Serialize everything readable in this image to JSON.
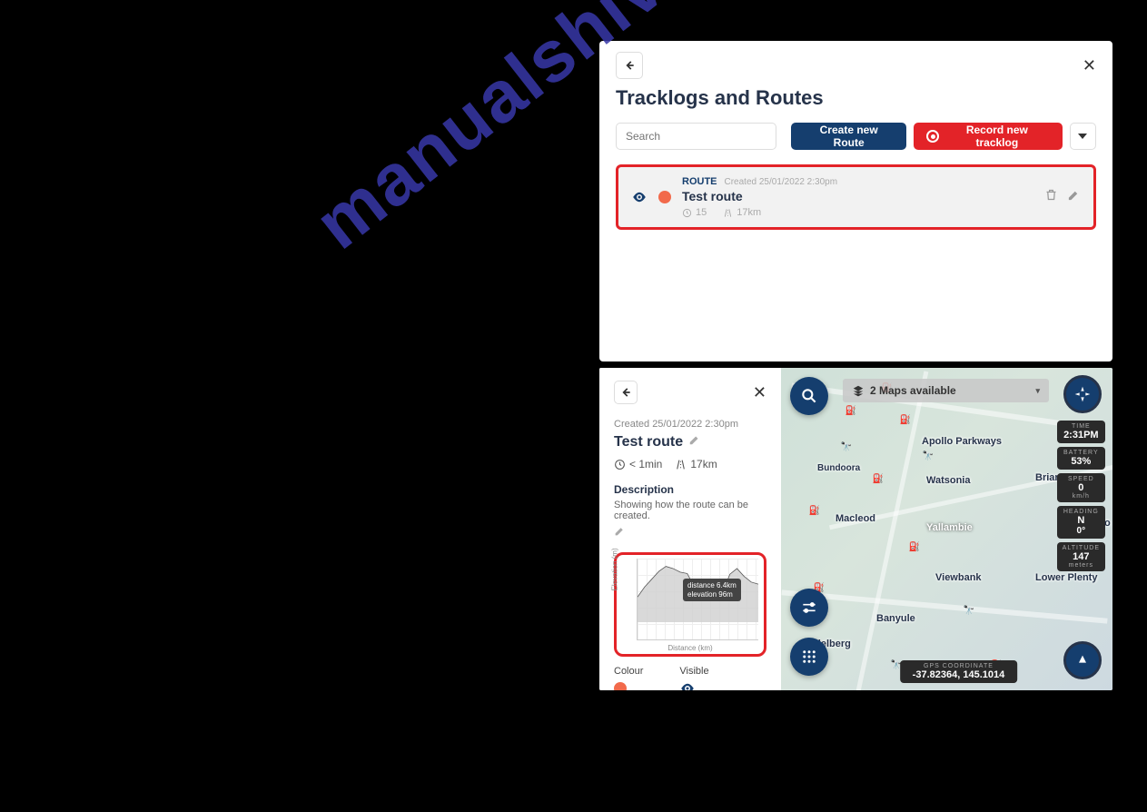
{
  "watermark": "manualshive.com",
  "panel1": {
    "title": "Tracklogs and Routes",
    "search_placeholder": "Search",
    "create_route": "Create new Route",
    "record_tracklog": "Record new tracklog",
    "route": {
      "type": "ROUTE",
      "created": "Created 25/01/2022 2:30pm",
      "name": "Test route",
      "waypoints": "15",
      "distance": "17km"
    }
  },
  "panel2": {
    "created": "Created 25/01/2022 2:30pm",
    "name": "Test route",
    "time": "< 1min",
    "distance": "17km",
    "desc_heading": "Description",
    "description": "Showing how the route can be created.",
    "colour_label": "Colour",
    "visible_label": "Visible",
    "chart_tooltip_dist": "distance 6.4km",
    "chart_tooltip_elev": "elevation 96m",
    "chart_ylabel": "Elevation (m)",
    "chart_xlabel": "Distance (km)"
  },
  "map": {
    "maps_available": "2 Maps available",
    "labels": {
      "apollo": "Apollo Parkways",
      "bundoora": "Bundoora",
      "watsonia": "Watsonia",
      "briar": "Briar Hill",
      "macleod": "Macleod",
      "yallambie": "Yallambie",
      "montmo": "Montmo",
      "viewbank": "Viewbank",
      "lowerplenty": "Lower Plenty",
      "banyule": "Banyule",
      "heidelberg": "Heidelberg"
    },
    "hud": {
      "time_label": "TIME",
      "time_val": "2:31PM",
      "batt_label": "BATTERY",
      "batt_val": "53%",
      "speed_label": "SPEED",
      "speed_val": "0",
      "speed_unit": "km/h",
      "head_label": "HEADING",
      "head_val": "N",
      "head_deg": "0°",
      "alt_label": "ALTITUDE",
      "alt_val": "147",
      "alt_unit": "meters"
    },
    "gps_label": "GPS COORDINATE",
    "gps_val": "-37.82364, 145.1014"
  },
  "chart_data": {
    "type": "line",
    "title": "",
    "xlabel": "Distance (km)",
    "ylabel": "Elevation (m)",
    "x": [
      0,
      1,
      2,
      3,
      4,
      5,
      6,
      7,
      8,
      9,
      10,
      11,
      12,
      13,
      14,
      15,
      16,
      17
    ],
    "values": [
      50,
      70,
      85,
      100,
      110,
      105,
      98,
      96,
      70,
      55,
      45,
      50,
      60,
      95,
      105,
      90,
      80,
      75
    ],
    "ylim": [
      0,
      125
    ],
    "xlim": [
      0,
      17
    ],
    "tooltip": {
      "x": 6.4,
      "y": 96
    }
  }
}
